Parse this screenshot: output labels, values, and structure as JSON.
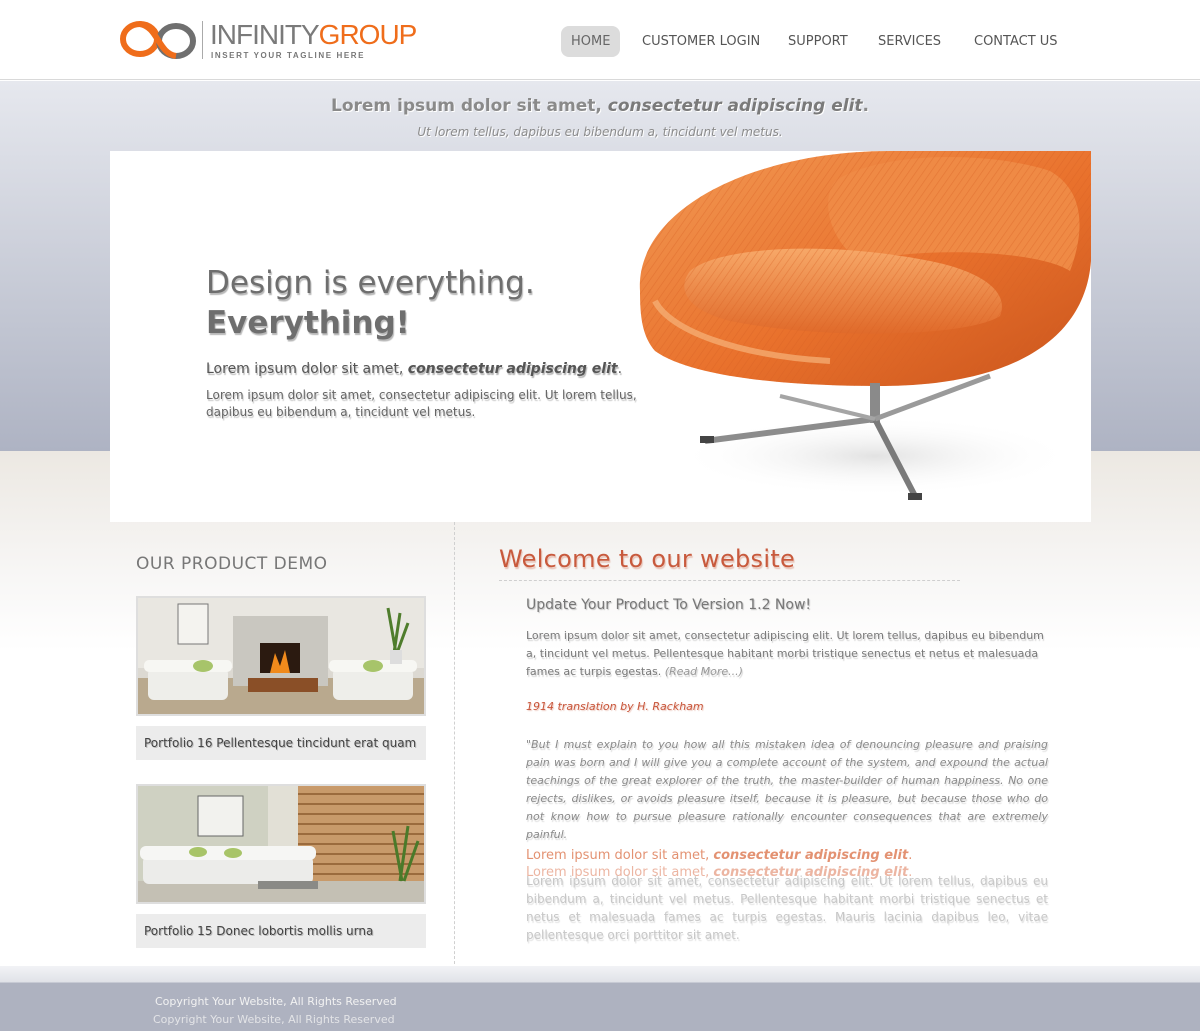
{
  "header": {
    "logo": {
      "name_part1": "INFINITY",
      "name_part2": "GROUP",
      "tagline": "INSERT YOUR TAGLINE HERE",
      "icon": "infinity-icon"
    },
    "nav": [
      {
        "label": "HOME",
        "active": true
      },
      {
        "label": "CUSTOMER LOGIN",
        "active": false
      },
      {
        "label": "SUPPORT",
        "active": false
      },
      {
        "label": "SERVICES",
        "active": false
      },
      {
        "label": "CONTACT US",
        "active": false
      }
    ]
  },
  "hero": {
    "tagline_plain": "Lorem ipsum dolor sit amet,",
    "tagline_italic": "consectetur adipiscing elit",
    "tagline_end": ".",
    "subtagline": "Ut lorem tellus, dapibus eu bibendum a, tincidunt vel metus.",
    "heading_line1": "Design is everything.",
    "heading_line2": "Everything!",
    "lead_plain": "Lorem ipsum dolor sit amet,",
    "lead_italic": "consectetur adipiscing elit",
    "lead_end": ".",
    "text": "Lorem ipsum dolor sit amet, consectetur adipiscing elit. Ut lorem tellus, dapibus eu bibendum a, tincidunt vel metus.",
    "image": "orange-armchair"
  },
  "sidebar": {
    "title": "OUR PRODUCT DEMO",
    "items": [
      {
        "caption": "Portfolio 16 Pellentesque tincidunt erat quam",
        "image": "living-room-fireplace"
      },
      {
        "caption": "Portfolio 15 Donec lobortis mollis urna",
        "image": "living-room-blinds"
      }
    ]
  },
  "main": {
    "welcome_title": "Welcome to our website",
    "update_title": "Update Your Product To Version 1.2 Now!",
    "update_text": "Lorem ipsum dolor sit amet, consectetur adipiscing elit. Ut lorem tellus, dapibus eu bibendum a, tincidunt vel metus. Pellentesque habitant morbi tristique senectus et netus et malesuada fames ac turpis egestas.",
    "read_more": "(Read More...)",
    "translation_title": "1914 translation by H. Rackham",
    "quote": "\"But I must explain to you how all this mistaken idea of denouncing pleasure and praising pain was born and I will give you a complete account of the system, and expound the actual teachings of the great explorer of the truth, the master-builder of human happiness. No one rejects, dislikes, or avoids pleasure itself, because it is pleasure, but because those who do not know how to pursue pleasure rationally encounter consequences that are extremely painful.",
    "accent_plain": "Lorem ipsum dolor sit amet,",
    "accent_italic": "consectetur adipiscing elit",
    "accent_end": ".",
    "accent_text": "Lorem ipsum dolor sit amet, consectetur adipiscing elit. Ut lorem tellus, dapibus eu bibendum a, tincidunt vel metus. Pellentesque habitant morbi tristique senectus et netus et malesuada fames ac turpis egestas. Mauris lacinia dapibus leo, vitae pellentesque orci porttitor sit amet."
  },
  "footer": {
    "copyright": "Copyright Your Website, All Rights Reserved"
  },
  "colors": {
    "brand_orange": "#ef6d1b",
    "welcome_red": "#c85a3d",
    "band_top": "#e6e8ee",
    "band_bottom": "#aeb3c3",
    "footer": "#aeb2c0"
  }
}
